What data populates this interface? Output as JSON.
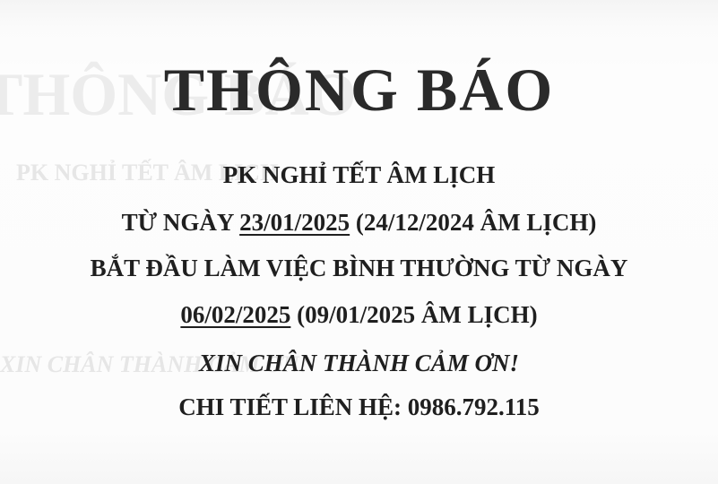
{
  "notice": {
    "title": "THÔNG BÁO",
    "line1": "PK NGHỈ TẾT ÂM LỊCH",
    "line2": {
      "prefix": "TỪ NGÀY ",
      "date": "23/01/2025",
      "suffix": " (24/12/2024 ÂM LỊCH)"
    },
    "line3": "BẮT ĐẦU LÀM VIỆC BÌNH THƯỜNG TỪ NGÀY",
    "line4": {
      "date": "06/02/2025",
      "suffix": " (09/01/2025 ÂM LỊCH)"
    },
    "line5": "XIN CHÂN THÀNH CẢM ƠN!",
    "line6": "CHI TIẾT LIÊN HỆ: 0986.792.115"
  },
  "colors": {
    "ink": "#222222",
    "paper": "#fdfdfd",
    "bleed_through": "#e6e6e6"
  }
}
